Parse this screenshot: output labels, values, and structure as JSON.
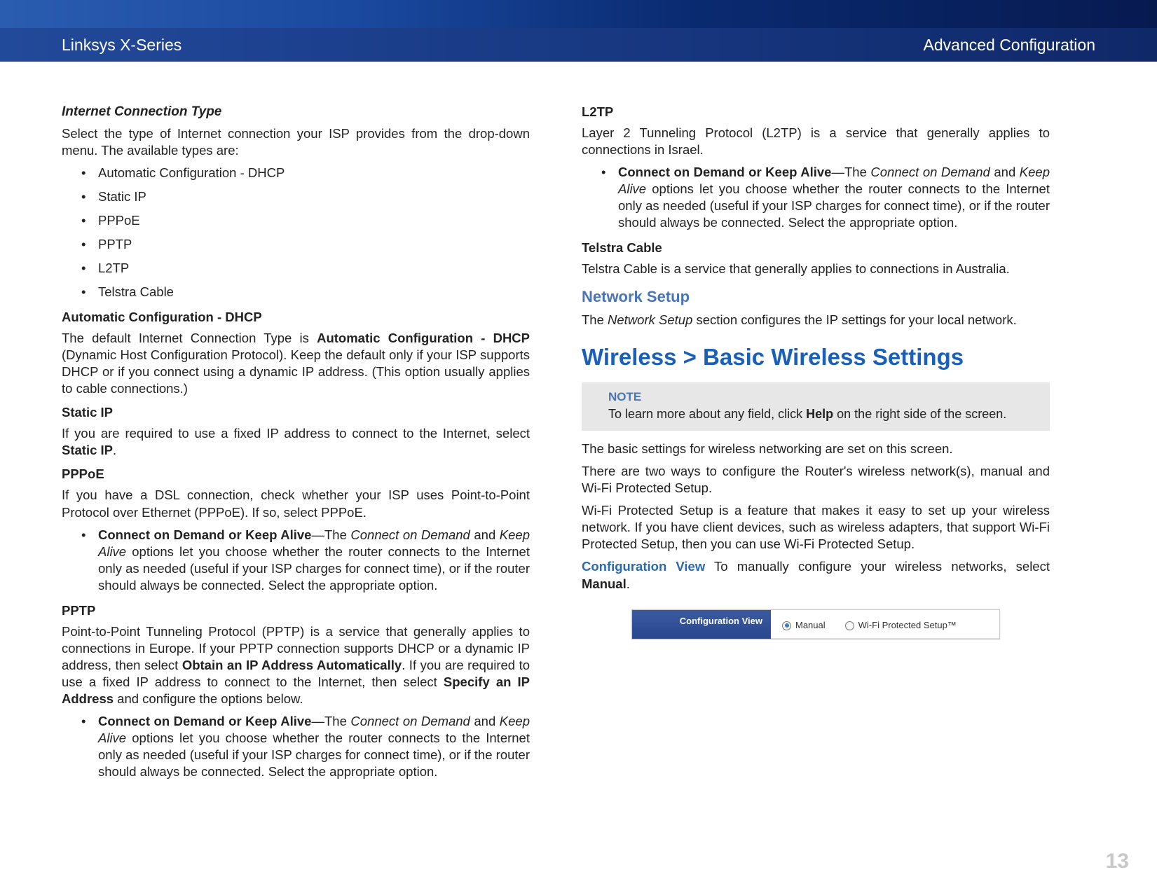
{
  "header": {
    "left": "Linksys X-Series",
    "right": "Advanced Configuration"
  },
  "left_col": {
    "internet_type_heading": "Internet Connection Type",
    "internet_type_intro": "Select the type of Internet connection your ISP provides from the drop-down menu. The available types are:",
    "types": [
      "Automatic Configuration - DHCP",
      "Static IP",
      "PPPoE",
      "PPTP",
      "L2TP",
      "Telstra Cable"
    ],
    "auto_dhcp": {
      "heading": "Automatic Configuration - DHCP",
      "p_pre": "The default Internet Connection Type is ",
      "p_bold": "Automatic Configuration - DHCP",
      "p_post": " (Dynamic Host Configuration Protocol). Keep the default only if your ISP supports DHCP or if you connect using a dynamic IP address. (This option usually applies to cable connections.)"
    },
    "static_ip": {
      "heading": "Static IP",
      "p_pre": "If you are required to use a fixed IP address to connect to the Internet, select ",
      "p_bold": "Static IP",
      "p_post": "."
    },
    "pppoe": {
      "heading": "PPPoE",
      "p": "If you have a DSL connection, check whether your ISP uses Point-to-Point Protocol over Ethernet (PPPoE). If so, select PPPoE.",
      "bullet_bold": "Connect on Demand or Keep Alive",
      "bullet_pre": "—The ",
      "bullet_i1": "Connect on Demand",
      "bullet_mid": " and ",
      "bullet_i2": "Keep Alive",
      "bullet_post": " options let you choose whether the router connects to the Internet only as needed (useful if your ISP charges for connect time), or if the router should always be connected. Select the appropriate option."
    },
    "pptp": {
      "heading": "PPTP",
      "p_pre": "Point-to-Point Tunneling Protocol (PPTP) is a service that generally applies to connections in Europe. If your PPTP connection supports DHCP or a dynamic IP address, then select ",
      "p_bold1": "Obtain an IP Address Automatically",
      "p_mid": ". If you are required to use a fixed IP address to connect to the Internet, then select ",
      "p_bold2": "Specify an IP Address",
      "p_post": " and configure the options below.",
      "bullet_bold": "Connect on Demand or Keep Alive",
      "bullet_pre": "—The ",
      "bullet_i1": "Connect on Demand",
      "bullet_mid": " and ",
      "bullet_i2": "Keep Alive",
      "bullet_post": " options let you choose whether the router connects to the Internet only as needed (useful if your ISP charges for connect time), or if the router should always be connected. Select the appropriate option."
    }
  },
  "right_col": {
    "l2tp": {
      "heading": "L2TP",
      "p": "Layer 2 Tunneling Protocol (L2TP) is a service that generally applies to connections in Israel.",
      "bullet_bold": "Connect on Demand or Keep Alive",
      "bullet_pre": "—The ",
      "bullet_i1": "Connect on Demand",
      "bullet_mid": " and ",
      "bullet_i2": "Keep Alive",
      "bullet_post": " options let you choose whether the router connects to the Internet only as needed (useful if your ISP charges for connect time), or if the router should always be connected. Select the appropriate option."
    },
    "telstra": {
      "heading": "Telstra Cable",
      "p": "Telstra Cable is a service that generally applies to connections in Australia."
    },
    "network_setup": {
      "heading": "Network Setup",
      "p_pre": "The ",
      "p_ital": "Network Setup",
      "p_post": " section configures the IP settings for your local network."
    },
    "wireless": {
      "heading": "Wireless > Basic Wireless Settings",
      "note_label": "NOTE",
      "note_pre": "To learn more about any field, click ",
      "note_bold": "Help",
      "note_post": " on the right side of the screen.",
      "p1": "The basic settings for wireless networking are set on this screen.",
      "p2": "There are two ways to configure the Router's wireless network(s), manual and Wi-Fi Protected Setup.",
      "p3": "Wi-Fi Protected Setup is a feature that makes it easy to set up your wireless network. If you have client devices, such as wireless adapters, that support Wi-Fi Protected Setup, then you can use Wi-Fi Protected Setup.",
      "cfg_label": "Configuration View",
      "cfg_text": "  To manually configure your wireless networks, select ",
      "cfg_bold": "Manual",
      "cfg_post": "."
    },
    "screenshot": {
      "label": "Configuration View",
      "opt_manual": "Manual",
      "opt_wps": "Wi-Fi Protected Setup™"
    }
  },
  "page_number": "13"
}
